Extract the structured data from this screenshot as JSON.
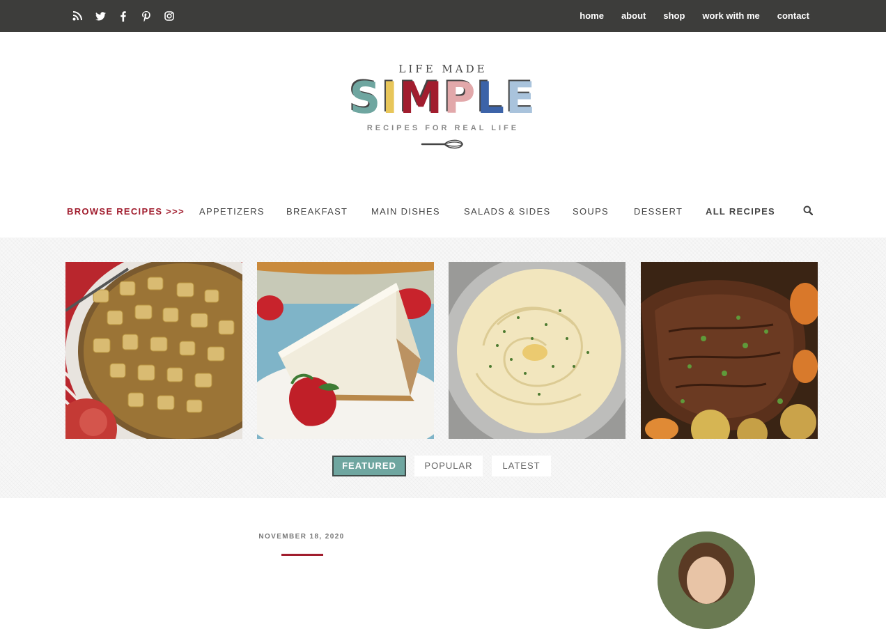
{
  "topbar": {
    "social_icons": [
      "rss-icon",
      "twitter-icon",
      "facebook-icon",
      "pinterest-icon",
      "instagram-icon"
    ],
    "nav": [
      "home",
      "about",
      "shop",
      "work with me",
      "contact"
    ]
  },
  "logo": {
    "top_line": "LIFE MADE",
    "main_word": [
      "S",
      "I",
      "M",
      "P",
      "L",
      "E"
    ],
    "main_colors": [
      "#6fa6a0",
      "#e8c65a",
      "#a11d2e",
      "#e2a8aa",
      "#3c63a8",
      "#a9c3dc"
    ],
    "tagline": "RECIPES FOR REAL LIFE"
  },
  "category_nav": {
    "browse": "BROWSE RECIPES >>>",
    "items": [
      "APPETIZERS",
      "BREAKFAST",
      "MAIN DISHES",
      "SALADS & SIDES",
      "SOUPS",
      "DESSERT"
    ],
    "all": "ALL RECIPES",
    "search_icon": "search-icon"
  },
  "featured": {
    "tiles": [
      "apple-filling-photo",
      "cheesecake-photo",
      "mashed-potatoes-photo",
      "pot-roast-photo"
    ],
    "tabs": [
      "FEATURED",
      "POPULAR",
      "LATEST"
    ],
    "active_tab": "FEATURED"
  },
  "post": {
    "date": "NOVEMBER 18, 2020"
  },
  "colors": {
    "topbar": "#3d3d3b",
    "accent_red": "#a11d2e",
    "accent_teal": "#6fa6a0"
  }
}
